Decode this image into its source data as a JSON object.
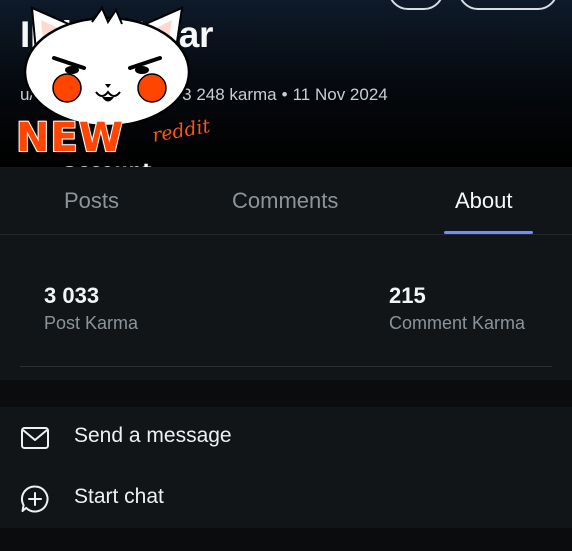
{
  "profile": {
    "username": "IL        icultYear",
    "meta": {
      "prefix": "u/",
      "karma": "3 248 karma",
      "separator": "•",
      "joined": "11 Nov 2024"
    }
  },
  "badge": {
    "new_text": "NEW",
    "brand_text": "reddit",
    "account_text": "account"
  },
  "tabs": [
    {
      "label": "Posts",
      "active": false
    },
    {
      "label": "Comments",
      "active": false
    },
    {
      "label": "About",
      "active": true
    }
  ],
  "stats": {
    "post_karma": {
      "value": "3 033",
      "label": "Post Karma"
    },
    "comment_karma": {
      "value": "215",
      "label": "Comment Karma"
    }
  },
  "actions": [
    {
      "label": "Send a message",
      "icon": "mail-icon"
    },
    {
      "label": "Start chat",
      "icon": "chat-plus-icon"
    }
  ],
  "colors": {
    "accent": "#6a8fff",
    "badge_orange": "#ff4500",
    "background": "#0b0c0d",
    "panel": "#121517"
  }
}
